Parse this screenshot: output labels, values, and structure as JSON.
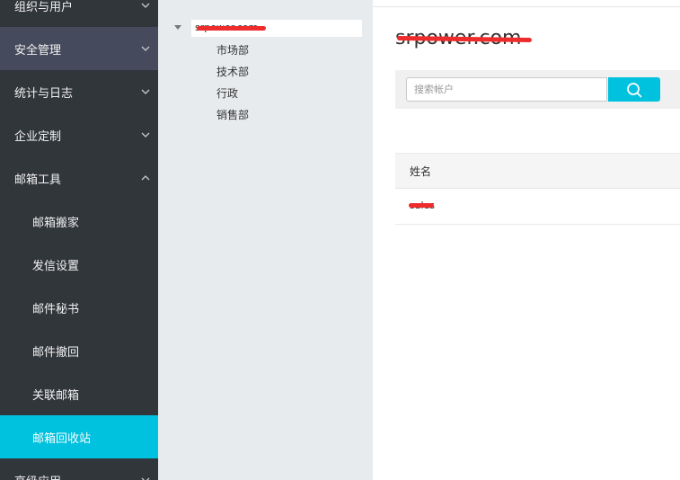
{
  "sidebar": {
    "items": [
      {
        "label": "组织与用户",
        "expanded": false
      },
      {
        "label": "安全管理",
        "expanded": false
      },
      {
        "label": "统计与日志",
        "expanded": false
      },
      {
        "label": "企业定制",
        "expanded": false
      },
      {
        "label": "邮箱工具",
        "expanded": true,
        "children": [
          {
            "label": "邮箱搬家"
          },
          {
            "label": "发信设置"
          },
          {
            "label": "邮件秘书"
          },
          {
            "label": "邮件撤回"
          },
          {
            "label": "关联邮箱"
          },
          {
            "label": "邮箱回收站",
            "active": true
          }
        ]
      },
      {
        "label": "高级应用",
        "expanded": false
      }
    ]
  },
  "tree": {
    "root_label": "srpower.com",
    "children": [
      "市场部",
      "技术部",
      "行政",
      "销售部"
    ]
  },
  "main": {
    "domain_title": "srpower.com",
    "search": {
      "placeholder": "搜索帐户",
      "value": ""
    },
    "table": {
      "columns": [
        "姓名"
      ],
      "rows": [
        [
          "sales"
        ]
      ]
    }
  },
  "colors": {
    "sidebar_bg": "#31363b",
    "sidebar_highlight": "#454b5c",
    "accent": "#00c1de",
    "redaction": "#ee2c2c"
  },
  "icons": {
    "collapsed": "chevron-down-icon",
    "expanded": "chevron-up-icon",
    "tree_toggle": "caret-down-icon",
    "search": "search-icon"
  }
}
